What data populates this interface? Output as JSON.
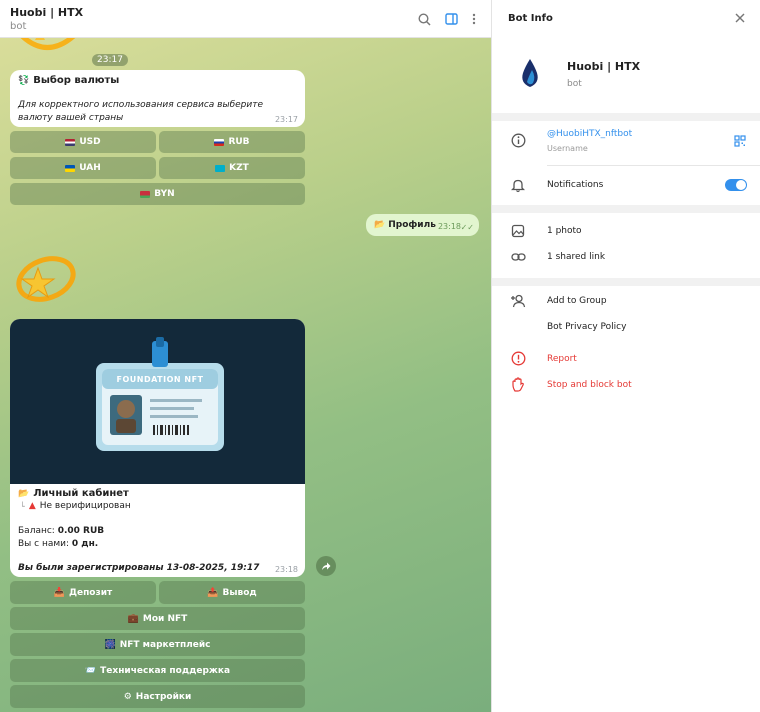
{
  "chat_header": {
    "title": "Huobi | HTX",
    "subtitle": "bot"
  },
  "messages": {
    "time_pill_1": "23:17",
    "currency": {
      "title": "Выбор валюты",
      "text": "Для корректного использования сервиса выберите валюту вашей страны",
      "time": "23:17",
      "buttons": [
        "USD",
        "RUB",
        "UAH",
        "KZT",
        "BYN"
      ]
    },
    "outgoing": {
      "text": "Профиль",
      "time": "23:18"
    },
    "profile": {
      "card_header": "FOUNDATION NFT",
      "title": "Личный кабинет",
      "status": "Не верифицирован",
      "balance_label": "Баланс:",
      "balance_value": "0.00 RUB",
      "with_us_label": "Вы с нами:",
      "with_us_value": "0 дн.",
      "registered": "Вы были зарегистрированы 13-08-2025, 19:17",
      "time": "23:18",
      "buttons": {
        "deposit": "Депозит",
        "withdraw": "Вывод",
        "my_nft": "Мои NFT",
        "marketplace": "NFT маркетплейс",
        "support": "Техническая поддержка",
        "settings": "Настройки"
      }
    }
  },
  "info": {
    "title": "Bot Info",
    "name": "Huobi | HTX",
    "sub": "bot",
    "username": "@HuobiHTX_nftbot",
    "username_label": "Username",
    "notifications": "Notifications",
    "photos": "1 photo",
    "links": "1 shared link",
    "add_to_group": "Add to Group",
    "privacy": "Bot Privacy Policy",
    "report": "Report",
    "stop": "Stop and block bot"
  },
  "colors": {
    "accent": "#3390ec",
    "danger": "#e53935",
    "brand": "#1a2f6b"
  }
}
